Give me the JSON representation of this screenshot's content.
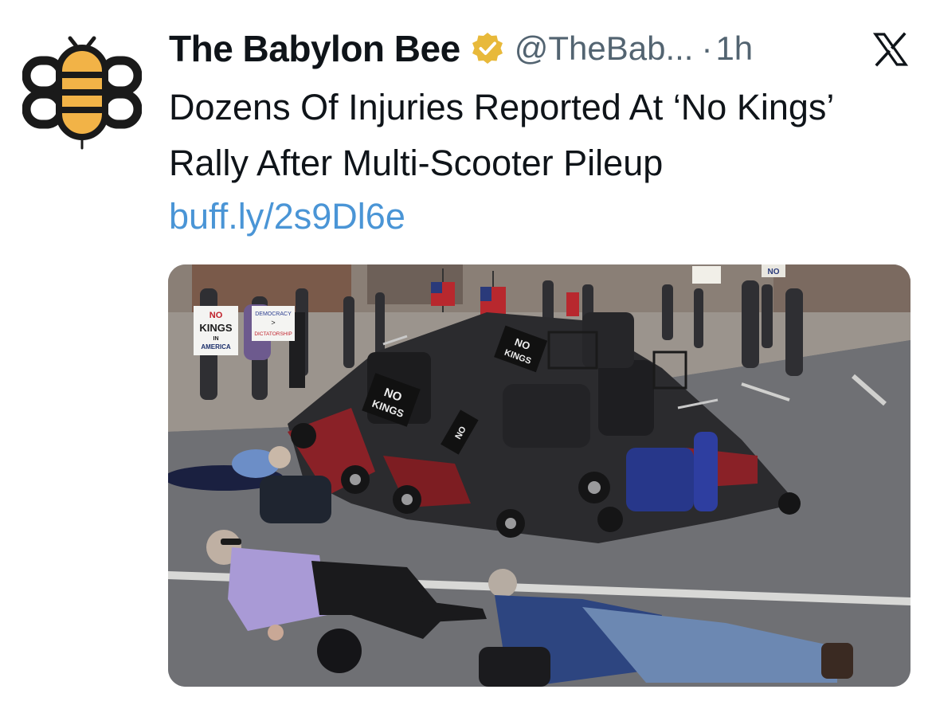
{
  "tweet": {
    "display_name": "The Babylon Bee",
    "handle": "@TheBab...",
    "separator": "·",
    "timestamp": "1h",
    "text": "Dozens Of Injuries Reported At ‘No Kings’ Rally After Multi-Scooter Pileup",
    "link": "buff.ly/2s9Dl6e"
  },
  "photo": {
    "sign_left_line1": "NO",
    "sign_left_line2": "KINGS",
    "sign_left_line3": "IN",
    "sign_left_line4": "AMERICA",
    "sign_right_line1": "DEMOCRACY",
    "sign_right_line2": ">",
    "sign_right_line3": "DICTATORSHIP",
    "scooter_sign_1_line1": "NO",
    "scooter_sign_1_line2": "KINGS",
    "scooter_sign_2_line1": "NO",
    "scooter_sign_2_line2": "KINGS",
    "scooter_sign_3": "NO",
    "banner_top_right": "NO"
  },
  "icons": {
    "avatar": "babylon-bee-logo-icon",
    "verified": "verified-gold-badge-icon",
    "platform": "x-logo-icon"
  },
  "colors": {
    "link": "#4a95d6",
    "secondary_text": "#536471",
    "bee_yellow": "#f2b347",
    "badge_gold": "#e8b93a"
  }
}
